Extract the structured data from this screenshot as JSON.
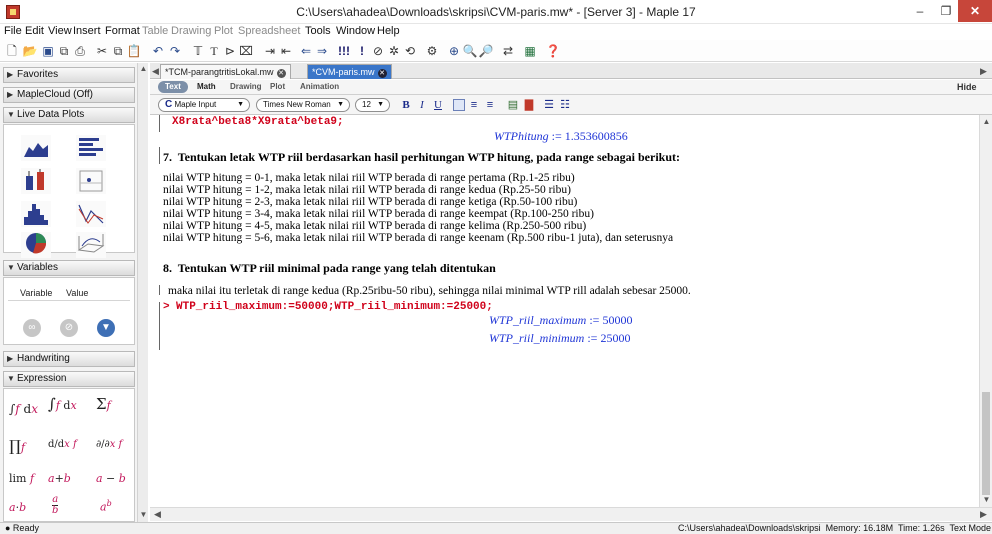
{
  "window": {
    "title": "C:\\Users\\ahadea\\Downloads\\skripsi\\CVM-paris.mw* - [Server 3] - Maple 17",
    "minimize": "–",
    "maximize": "❐",
    "close": "✕"
  },
  "menu": [
    "File",
    "Edit",
    "View",
    "Insert",
    "Format",
    "Table",
    "Drawing",
    "Plot",
    "Spreadsheet",
    "Tools",
    "Window",
    "Help"
  ],
  "palette": {
    "favorites": "Favorites",
    "maplecloud": "MapleCloud (Off)",
    "live_data_plots": "Live Data Plots",
    "variables": "Variables",
    "variable_col": "Variable",
    "value_col": "Value",
    "handwriting": "Handwriting",
    "expression": "Expression",
    "expr_items": [
      "∫f dx",
      "∫ f dx",
      "Σ f",
      "∏ f",
      "d/dx f",
      "∂/∂x f",
      "lim f",
      "a+b",
      "a − b",
      "a·b",
      "a/b",
      "a^b"
    ]
  },
  "tabs": [
    {
      "label": "*TCM-parangtritisLokal.mw"
    },
    {
      "label": "*CVM-paris.mw"
    }
  ],
  "modes": [
    "Text",
    "Math",
    "Drawing",
    "Plot",
    "Animation"
  ],
  "hide_label": "Hide",
  "format": {
    "input_style": "Maple Input",
    "font": "Times New Roman",
    "size": "12",
    "bold": "B",
    "italic": "I",
    "underline": "U"
  },
  "document": {
    "code_line_1": "X8rata^beta8*X9rata^beta9;",
    "wtp_hitung_label": "WTPhitung",
    "wtp_hitung_value": ":= 1.353600856",
    "heading_7": "7.  Tentukan letak WTP riil berdasarkan hasil perhitungan WTP hitung, pada range sebagai berikut:",
    "ranges": [
      "nilai WTP hitung = 0-1, maka letak nilai riil WTP berada di range pertama (Rp.1-25 ribu)",
      "nilai WTP hitung = 1-2, maka letak nilai riil WTP berada di range kedua (Rp.25-50 ribu)",
      "nilai WTP hitung = 2-3, maka letak nilai riil WTP berada di range ketiga (Rp.50-100 ribu)",
      "nilai WTP hitung = 3-4, maka letak nilai riil WTP berada di range keempat (Rp.100-250 ribu)",
      "nilai WTP hitung = 4-5, maka letak nilai riil WTP berada di range kelima (Rp.250-500 ribu)",
      "nilai WTP hitung = 5-6, maka letak nilai riil WTP berada di range keenam (Rp.500 ribu-1 juta), dan seterusnya"
    ],
    "heading_8": "8.  Tentukan WTP riil minimal pada range yang telah ditentukan",
    "conclusion": "maka nilai itu terletak di range kedua (Rp.25ribu-50 ribu), sehingga nilai minimal WTP rill adalah sebesar 25000.",
    "prompt": ">",
    "code_line_2": "WTP_riil_maximum:=50000;WTP_riil_minimum:=25000;",
    "out_max_label": "WTP_riil_maximum",
    "out_max_value": ":= 50000",
    "out_min_label": "WTP_riil_minimum",
    "out_min_value": ":= 25000"
  },
  "status": {
    "ready": "● Ready",
    "right": "C:\\Users\\ahadea\\Downloads\\skripsi  Memory: 16.18M  Time: 1.26s  Text Mode"
  },
  "colors": {
    "maple_input": "#d0021b",
    "maple_output": "#1f35d6",
    "tab_active": "#3a76c9"
  }
}
